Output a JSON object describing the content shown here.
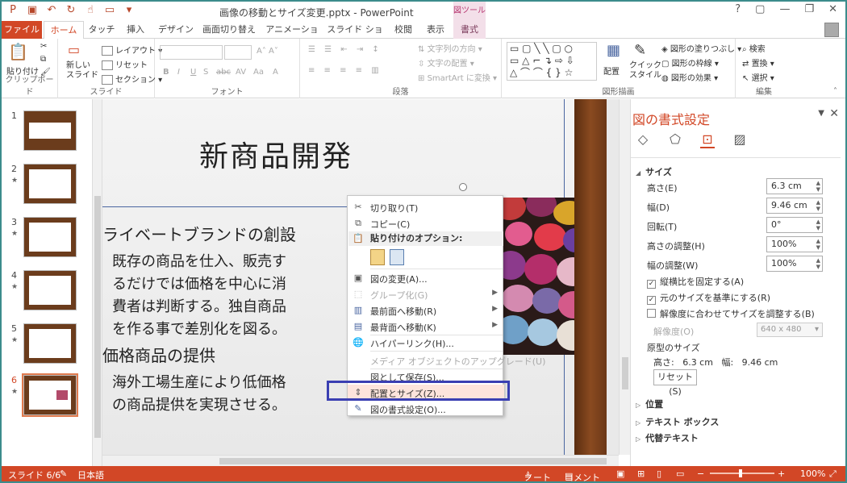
{
  "window": {
    "doc_title": "画像の移動とサイズ変更.pptx - PowerPoint",
    "context_tool": "図ツール",
    "help": "?",
    "minimize": "—",
    "restore": "❐",
    "close": "✕"
  },
  "tabs": [
    "ファイル",
    "ホーム",
    "タッチ",
    "挿入",
    "デザイン",
    "画面切り替え",
    "アニメーション",
    "スライド ショー",
    "校閲",
    "表示",
    "書式"
  ],
  "ribbon": {
    "clipboard": {
      "paste": "貼り付け",
      "label": "クリップボード"
    },
    "slides": {
      "new_slide": "新しい\nスライド",
      "layout": "レイアウト",
      "reset": "リセット",
      "section": "セクション",
      "label": "スライド"
    },
    "font": {
      "label": "フォント",
      "bold": "B",
      "italic": "I",
      "underline": "U",
      "shadow": "S",
      "strike": "abc",
      "spacing": "AV",
      "case": "Aa",
      "color": "A"
    },
    "paragraph": {
      "text_dir": "文字列の方向",
      "align_text": "文字の配置",
      "smartart": "SmartArt に変換",
      "label": "段落"
    },
    "drawing": {
      "arrange": "配置",
      "quick_style": "クイック\nスタイル",
      "fill": "図形の塗りつぶし",
      "outline": "図形の枠線",
      "effects": "図形の効果",
      "label": "図形描画"
    },
    "editing": {
      "find": "検索",
      "replace": "置換",
      "select": "選択",
      "label": "編集"
    }
  },
  "thumbnails": [
    {
      "num": "1",
      "star": "★"
    },
    {
      "num": "2",
      "star": "★"
    },
    {
      "num": "3",
      "star": "★"
    },
    {
      "num": "4",
      "star": "★"
    },
    {
      "num": "5",
      "star": "★"
    },
    {
      "num": "6",
      "star": "★"
    }
  ],
  "slide": {
    "title": "新商品開発",
    "bullet1": "ライベートブランドの創設",
    "para1": "既存の商品を仕入、販売す\nるだけでは価格を中心に消\n費者は判断する。独自商品\nを作る事で差別化を図る。",
    "bullet2": "価格商品の提供",
    "para2": "海外工場生産により低価格\nの商品提供を実現させる。"
  },
  "context_menu": {
    "cut": "切り取り(T)",
    "copy": "コピー(C)",
    "paste_header": "貼り付けのオプション:",
    "change_pic": "図の変更(A)...",
    "group": "グループ化(G)",
    "bring_front": "最前面へ移動(R)",
    "send_back": "最背面へ移動(K)",
    "hyperlink": "ハイパーリンク(H)...",
    "media_upgrade": "メディア オブジェクトのアップグレード(U)",
    "save_as_pic": "図として保存(S)...",
    "size_pos": "配置とサイズ(Z)...",
    "format_pic": "図の書式設定(O)..."
  },
  "format_pane": {
    "title": "図の書式設定",
    "size_section": "サイズ",
    "height_label": "高さ(E)",
    "height_value": "6.3 cm",
    "width_label": "幅(D)",
    "width_value": "9.46 cm",
    "rotation_label": "回転(T)",
    "rotation_value": "0°",
    "scale_h_label": "高さの調整(H)",
    "scale_h_value": "100%",
    "scale_w_label": "幅の調整(W)",
    "scale_w_value": "100%",
    "lock_aspect": "縦横比を固定する(A)",
    "relative_orig": "元のサイズを基準にする(R)",
    "best_scale": "解像度に合わせてサイズを調整する(B)",
    "resolution_label": "解像度(O)",
    "resolution_value": "640 x 480",
    "original_size_label": "原型のサイズ",
    "original_size_value": "高さ:   6.3 cm   幅:   9.46 cm",
    "reset": "リセット(S)",
    "position": "位置",
    "textbox": "テキスト ボックス",
    "alt_text": "代替テキスト"
  },
  "status": {
    "slide": "スライド 6/6",
    "lang": "日本語",
    "notes": "ノート",
    "comments": "コメント",
    "zoom": "100%"
  },
  "colors": {
    "accent": "#d24726",
    "highlight_box": "#3a3fb2"
  }
}
